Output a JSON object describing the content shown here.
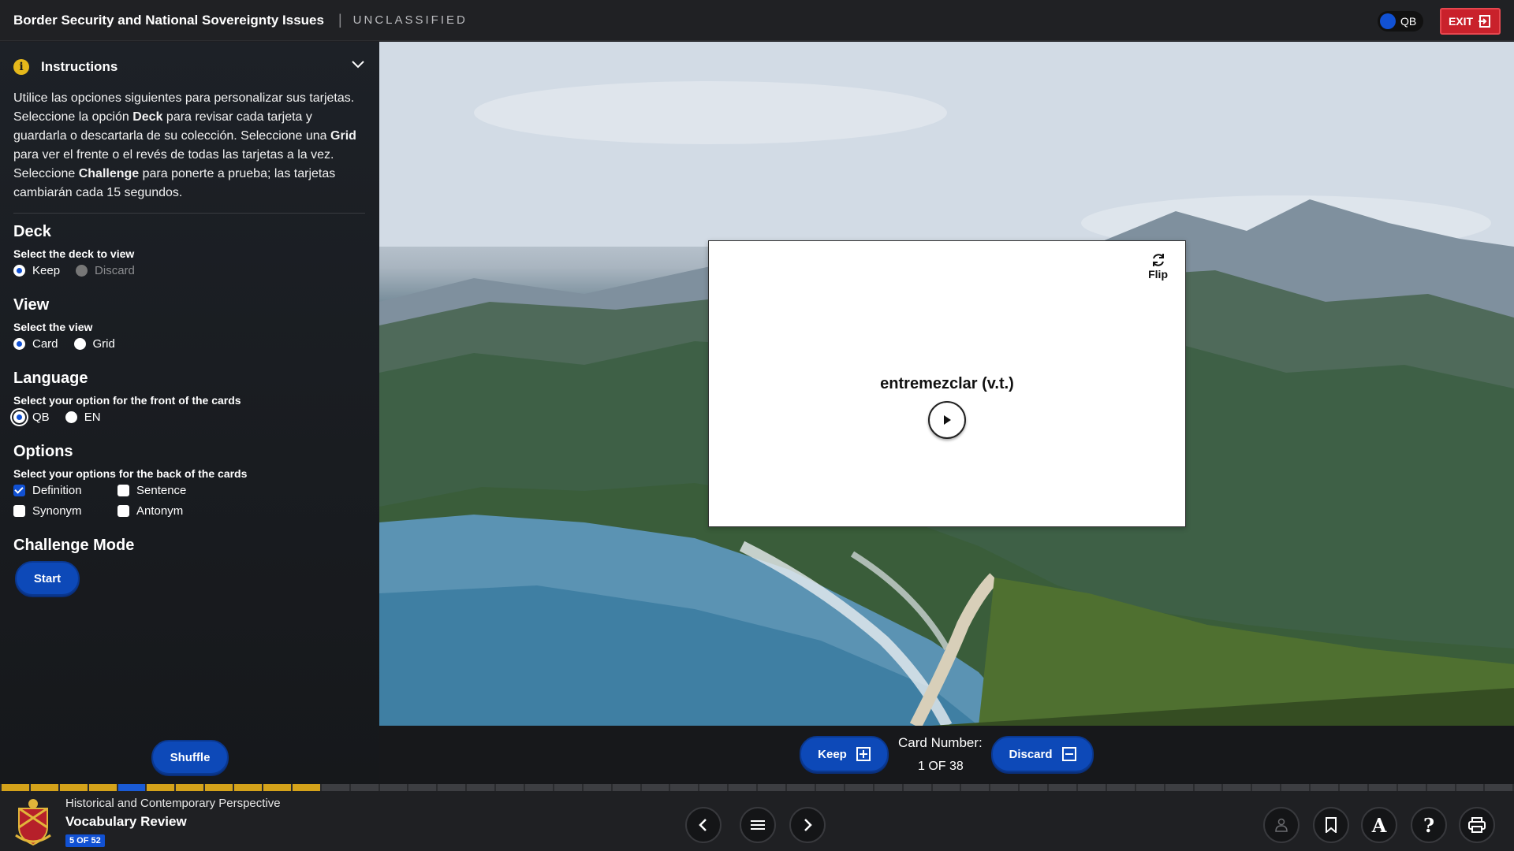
{
  "header": {
    "course_title": "Border Security and National Sovereignty Issues",
    "separator": "|",
    "classification": "UNCLASSIFIED",
    "language_toggle_label": "QB",
    "exit_label": "EXIT"
  },
  "sidebar": {
    "instructions_title": "Instructions",
    "instructions_parts": [
      "Utilice las opciones siguientes para personalizar sus tarjetas. Seleccione la opción ",
      "Deck",
      " para revisar cada tarjeta y guardarla o descartarla de su colección. Seleccione una ",
      "Grid",
      " para ver el frente o el revés de todas las tarjetas a la vez. Seleccione ",
      "Challenge",
      " para ponerte a prueba; las tarjetas cambiarán cada 15 segundos."
    ],
    "deck": {
      "title": "Deck",
      "subtitle": "Select the deck to view",
      "options": [
        "Keep",
        "Discard"
      ],
      "selected": "Keep"
    },
    "view": {
      "title": "View",
      "subtitle": "Select the view",
      "options": [
        "Card",
        "Grid"
      ],
      "selected": "Card"
    },
    "language": {
      "title": "Language",
      "subtitle": "Select your option for the front of the cards",
      "options": [
        "QB",
        "EN"
      ],
      "selected": "QB"
    },
    "options": {
      "title": "Options",
      "subtitle": "Select your options for the back of the cards",
      "items": [
        {
          "label": "Definition",
          "checked": true
        },
        {
          "label": "Sentence",
          "checked": false
        },
        {
          "label": "Synonym",
          "checked": false
        },
        {
          "label": "Antonym",
          "checked": false
        }
      ]
    },
    "challenge": {
      "title": "Challenge Mode",
      "start_label": "Start"
    },
    "shuffle_label": "Shuffle"
  },
  "card": {
    "flip_label": "Flip",
    "word": "entremezclar (v.t.)"
  },
  "actions": {
    "keep_label": "Keep",
    "discard_label": "Discard",
    "card_number_label": "Card Number:",
    "card_number_value": "1 OF 38"
  },
  "progress": {
    "total": 52,
    "current": 5,
    "completed": 11
  },
  "footer": {
    "subtitle": "Historical and Contemporary Perspective",
    "title": "Vocabulary Review",
    "page_badge": "5 OF 52"
  },
  "colors": {
    "accent_blue": "#1151d3",
    "exit_red": "#c9212b",
    "progress_gold": "#d4a21a"
  }
}
